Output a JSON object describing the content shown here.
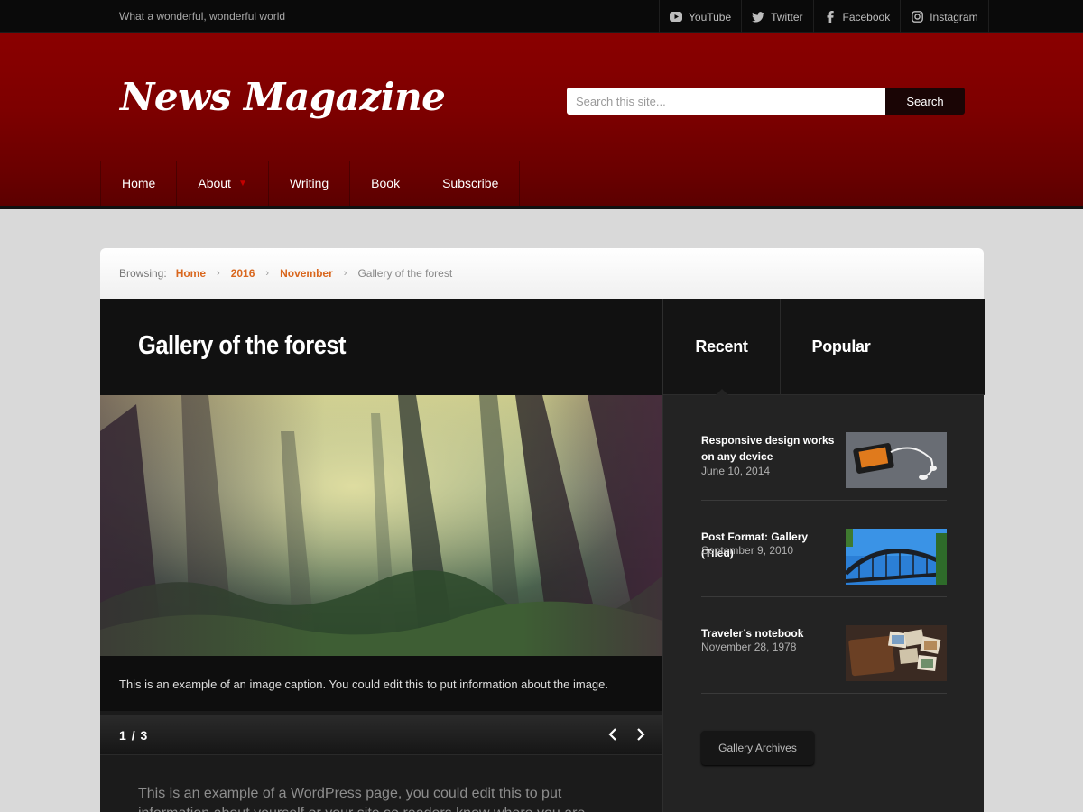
{
  "topbar": {
    "tagline": "What a wonderful, wonderful world",
    "social": [
      {
        "label": "YouTube",
        "icon": "youtube-icon"
      },
      {
        "label": "Twitter",
        "icon": "twitter-icon"
      },
      {
        "label": "Facebook",
        "icon": "facebook-icon"
      },
      {
        "label": "Instagram",
        "icon": "instagram-icon"
      }
    ]
  },
  "header": {
    "site_title": "News Magazine",
    "search": {
      "placeholder": "Search this site...",
      "button": "Search"
    },
    "nav": [
      {
        "label": "Home"
      },
      {
        "label": "About",
        "has_submenu": true
      },
      {
        "label": "Writing"
      },
      {
        "label": "Book"
      },
      {
        "label": "Subscribe"
      }
    ]
  },
  "breadcrumb": {
    "label": "Browsing:",
    "links": [
      "Home",
      "2016",
      "November"
    ],
    "current": "Gallery of the forest"
  },
  "post": {
    "title": "Gallery of the forest",
    "caption": "This is an example of an image caption. You could edit this to put information about the image.",
    "pager": {
      "current": "1",
      "separator": "/",
      "total": "3"
    },
    "body": "This is an example of a WordPress page, you could edit this to put information about yourself or your site so readers know where you are coming from. This is"
  },
  "sidebar": {
    "tabs": [
      "Recent",
      "Popular"
    ],
    "recent": [
      {
        "title": "Responsive design works on any device",
        "date": "June 10, 2014",
        "thumb": "phone-earbuds-photo"
      },
      {
        "title": "Post Format: Gallery (Tiled)",
        "date": "September 9, 2010",
        "thumb": "bridge-photo"
      },
      {
        "title": "Traveler’s notebook",
        "date": "November 28, 1978",
        "thumb": "notebook-photos-photo"
      }
    ],
    "archive_button": "Gallery Archives"
  },
  "colors": {
    "header_red": "#7d0000",
    "accent_orange": "#d9671e",
    "dark_panel": "#1b1b1b"
  }
}
